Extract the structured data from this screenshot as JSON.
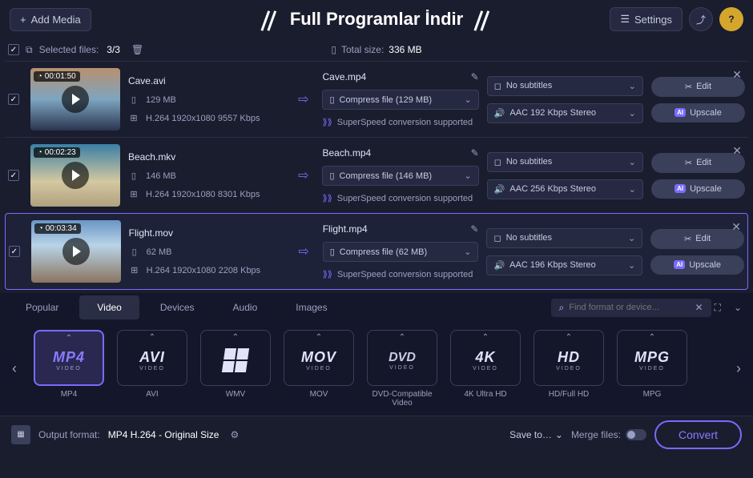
{
  "topbar": {
    "add_media": "Add Media",
    "title": "Full Programlar İndir",
    "settings": "Settings",
    "help": "?"
  },
  "selection": {
    "label": "Selected files:",
    "count": "3/3",
    "total_label": "Total size:",
    "total_value": "336 MB"
  },
  "files": [
    {
      "duration": "00:01:50",
      "name": "Cave.avi",
      "size": "129 MB",
      "codec": "H.264 1920x1080 9557 Kbps",
      "out_name": "Cave.mp4",
      "compress": "Compress file (129 MB)",
      "superspeed": "SuperSpeed conversion supported",
      "subtitles": "No subtitles",
      "audio": "AAC 192 Kbps Stereo",
      "thumb_class": "cave"
    },
    {
      "duration": "00:02:23",
      "name": "Beach.mkv",
      "size": "146 MB",
      "codec": "H.264 1920x1080 8301 Kbps",
      "out_name": "Beach.mp4",
      "compress": "Compress file (146 MB)",
      "superspeed": "SuperSpeed conversion supported",
      "subtitles": "No subtitles",
      "audio": "AAC 256 Kbps Stereo",
      "thumb_class": "beach"
    },
    {
      "duration": "00:03:34",
      "name": "Flight.mov",
      "size": "62 MB",
      "codec": "H.264 1920x1080 2208 Kbps",
      "out_name": "Flight.mp4",
      "compress": "Compress file (62 MB)",
      "superspeed": "SuperSpeed conversion supported",
      "subtitles": "No subtitles",
      "audio": "AAC 196 Kbps Stereo",
      "thumb_class": "flight"
    }
  ],
  "actions": {
    "edit": "Edit",
    "upscale": "Upscale"
  },
  "format_tabs": [
    "Popular",
    "Video",
    "Devices",
    "Audio",
    "Images"
  ],
  "format_active": 1,
  "format_search_placeholder": "Find format or device...",
  "formats": [
    {
      "logo": "MP4",
      "sub": "VIDEO",
      "label": "MP4",
      "selected": true
    },
    {
      "logo": "AVI",
      "sub": "VIDEO",
      "label": "AVI"
    },
    {
      "logo": "WIN",
      "sub": "",
      "label": "WMV"
    },
    {
      "logo": "MOV",
      "sub": "VIDEO",
      "label": "MOV"
    },
    {
      "logo": "DVD",
      "sub": "VIDEO",
      "label": "DVD-Compatible Video"
    },
    {
      "logo": "4K",
      "sub": "VIDEO",
      "label": "4K Ultra HD"
    },
    {
      "logo": "HD",
      "sub": "VIDEO",
      "label": "HD/Full HD"
    },
    {
      "logo": "MPG",
      "sub": "VIDEO",
      "label": "MPG"
    }
  ],
  "bottom": {
    "output_label": "Output format:",
    "output_value": "MP4 H.264 - Original Size",
    "save_to": "Save to…",
    "merge": "Merge files:",
    "convert": "Convert"
  }
}
